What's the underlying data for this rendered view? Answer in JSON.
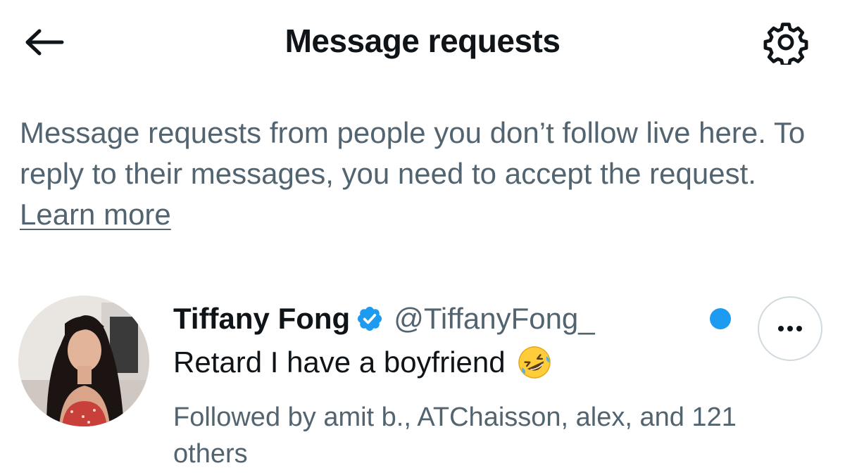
{
  "header": {
    "title": "Message requests",
    "back_icon": "arrow-left-icon",
    "settings_icon": "gear-icon"
  },
  "info": {
    "text": "Message requests from people you don’t follow live here. To reply to their messages, you need to accept the request.",
    "learn_more": "Learn more"
  },
  "request": {
    "display_name": "Tiffany Fong",
    "verified": true,
    "handle": "@TiffanyFong_",
    "message": "Retard I have a boyfriend",
    "emoji": "rolling-on-floor-laughing-emoji",
    "followed_by": "Followed by amit b., ATChaisson, alex, and 121 others",
    "unread": true
  },
  "colors": {
    "accent": "#1d9bf0",
    "text_primary": "#0f1419",
    "text_secondary": "#536471",
    "border": "#cfd9de"
  }
}
